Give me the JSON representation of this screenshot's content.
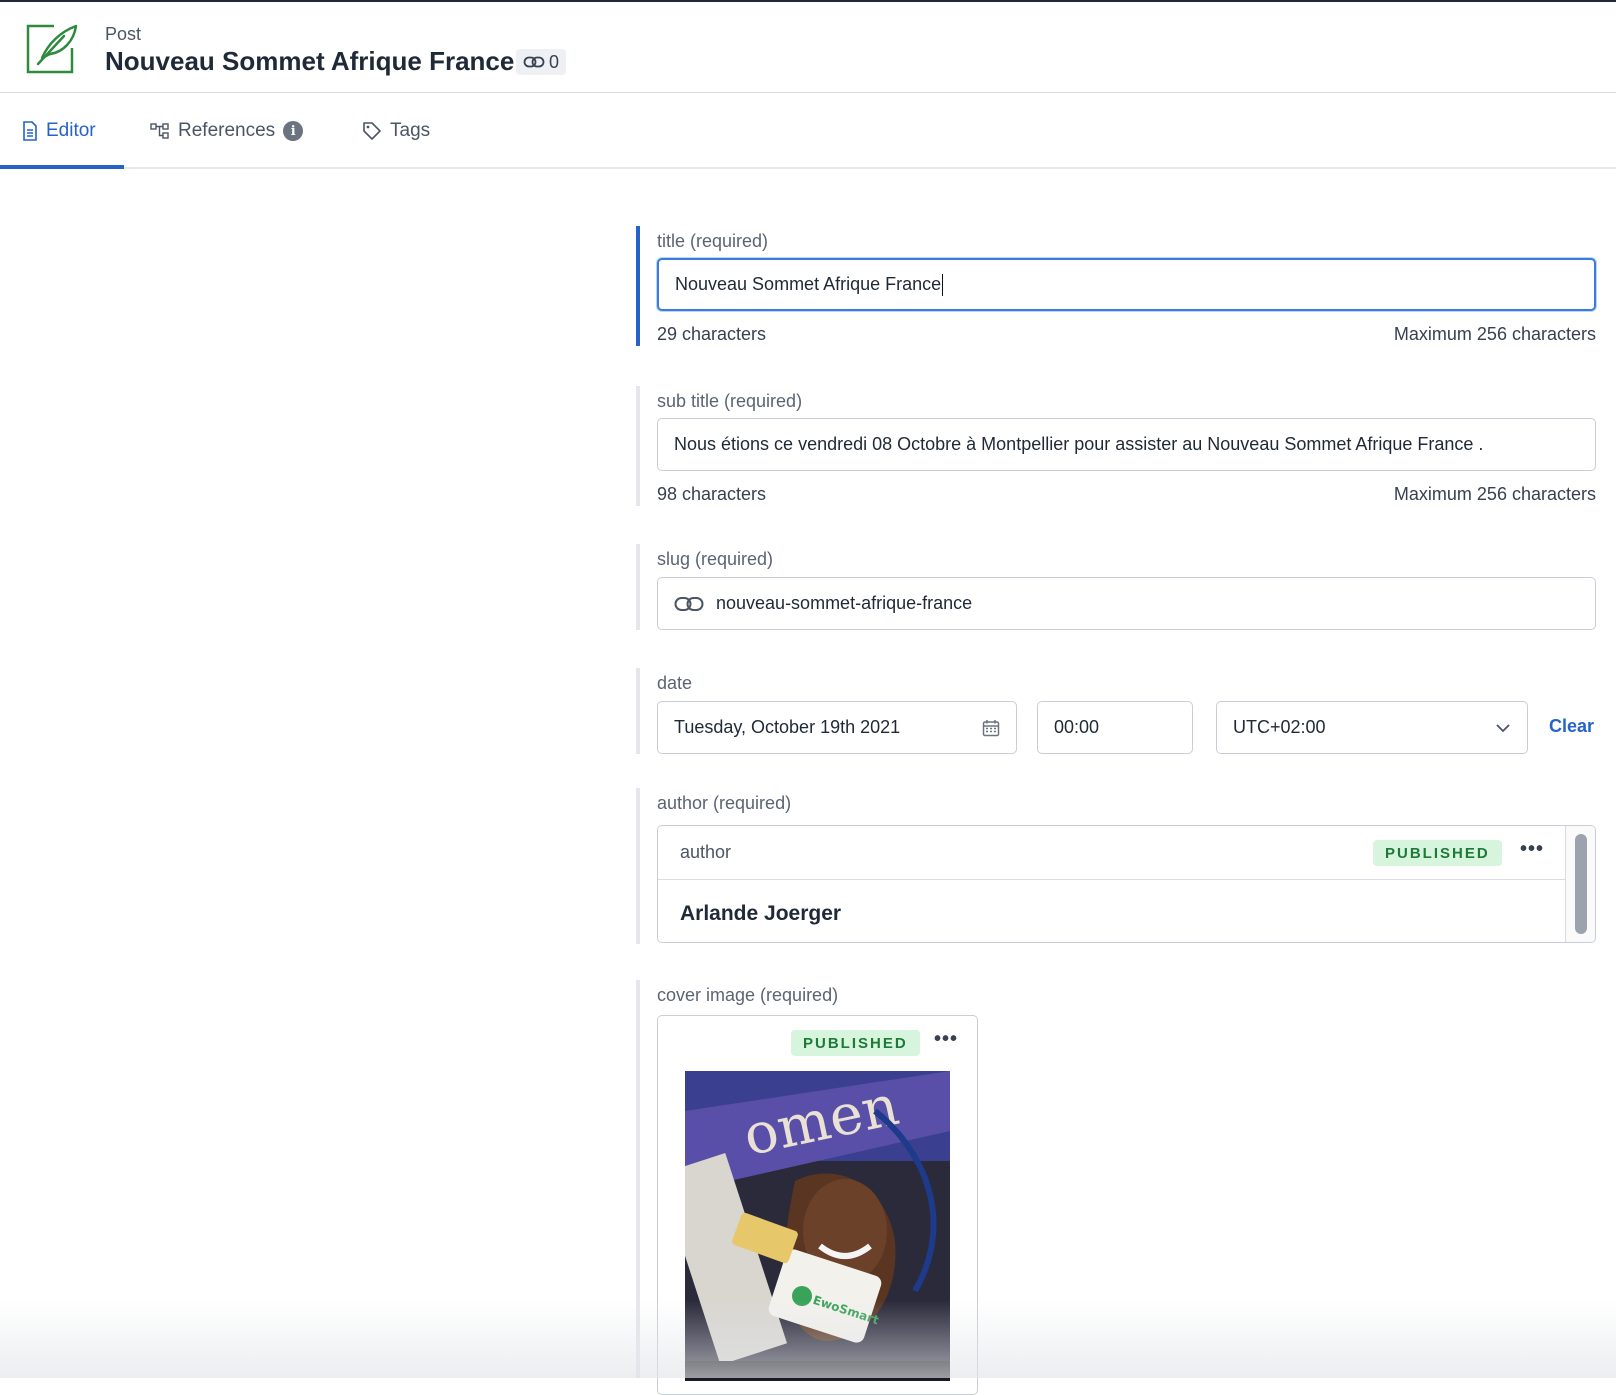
{
  "header": {
    "doc_type": "Post",
    "title": "Nouveau Sommet Afrique France",
    "references_count": "0"
  },
  "tabs": [
    {
      "label": "Editor",
      "icon": "document-icon",
      "active": true
    },
    {
      "label": "References",
      "icon": "tree-icon",
      "info": "i"
    },
    {
      "label": "Tags",
      "icon": "tag-icon"
    }
  ],
  "fields": {
    "title": {
      "label": "title (required)",
      "value": "Nouveau Sommet Afrique France",
      "count": "29 characters",
      "max": "Maximum 256 characters"
    },
    "subtitle": {
      "label": "sub title (required)",
      "value": "Nous étions ce vendredi 08 Octobre à Montpellier pour assister au Nouveau Sommet Afrique France .",
      "count": "98 characters",
      "max": "Maximum 256 characters"
    },
    "slug": {
      "label": "slug (required)",
      "value": "nouveau-sommet-afrique-france"
    },
    "date": {
      "label": "date",
      "date_value": "Tuesday, October 19th 2021",
      "time_value": "00:00",
      "timezone_value": "UTC+02:00",
      "clear_label": "Clear"
    },
    "author": {
      "label": "author (required)",
      "doc_type": "author",
      "status": "PUBLISHED",
      "name": "Arlande Joerger",
      "menu": "•••"
    },
    "cover": {
      "label": "cover image (required)",
      "status": "PUBLISHED",
      "menu": "•••",
      "image_text": "EwoSmart"
    }
  },
  "colors": {
    "accent": "#2563c9",
    "published_bg": "#d6f5dc",
    "published_fg": "#1f7a3a",
    "icon_green": "#2e8b3e"
  }
}
